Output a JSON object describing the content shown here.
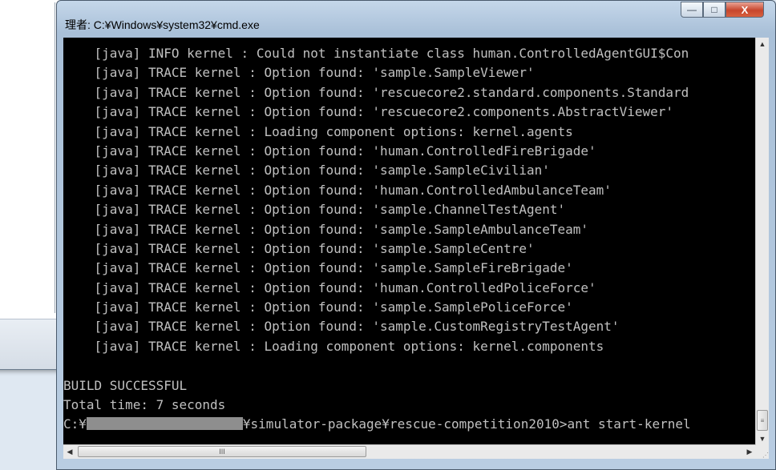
{
  "window": {
    "title": "理者: C:¥Windows¥system32¥cmd.exe",
    "buttons": {
      "minimize": "—",
      "maximize": "□",
      "close": "X"
    }
  },
  "console": {
    "lines": [
      "    [java] INFO kernel : Could not instantiate class human.ControlledAgentGUI$Con",
      "    [java] TRACE kernel : Option found: 'sample.SampleViewer'",
      "    [java] TRACE kernel : Option found: 'rescuecore2.standard.components.Standard",
      "    [java] TRACE kernel : Option found: 'rescuecore2.components.AbstractViewer'",
      "    [java] TRACE kernel : Loading component options: kernel.agents",
      "    [java] TRACE kernel : Option found: 'human.ControlledFireBrigade'",
      "    [java] TRACE kernel : Option found: 'sample.SampleCivilian'",
      "    [java] TRACE kernel : Option found: 'human.ControlledAmbulanceTeam'",
      "    [java] TRACE kernel : Option found: 'sample.ChannelTestAgent'",
      "    [java] TRACE kernel : Option found: 'sample.SampleAmbulanceTeam'",
      "    [java] TRACE kernel : Option found: 'sample.SampleCentre'",
      "    [java] TRACE kernel : Option found: 'sample.SampleFireBrigade'",
      "    [java] TRACE kernel : Option found: 'human.ControlledPoliceForce'",
      "    [java] TRACE kernel : Option found: 'sample.SamplePoliceForce'",
      "    [java] TRACE kernel : Option found: 'sample.CustomRegistryTestAgent'",
      "    [java] TRACE kernel : Loading component options: kernel.components",
      "",
      "BUILD SUCCESSFUL",
      "Total time: 7 seconds"
    ],
    "prompt_prefix": "C:¥",
    "prompt_suffix": "¥simulator-package¥rescue-competition2010>ant start-kernel"
  },
  "scrollbars": {
    "vertical": {
      "up": "▲",
      "down": "▼",
      "thumb_grip": "≡"
    },
    "horizontal": {
      "left": "◀",
      "right": "▶",
      "thumb_grip": "III"
    }
  },
  "colors": {
    "console_bg": "#000000",
    "console_text": "#c0c0c0",
    "close_button": "#c7462c"
  }
}
